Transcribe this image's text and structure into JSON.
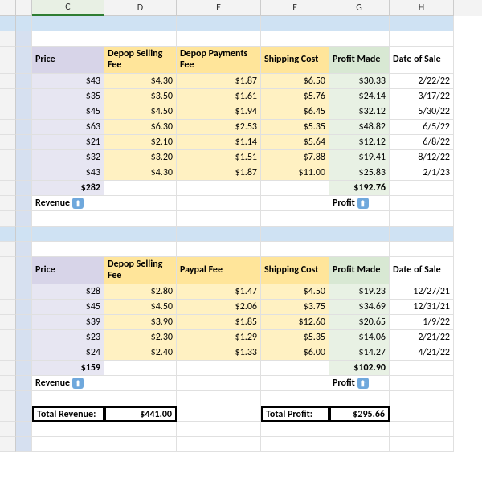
{
  "columns": [
    "",
    "",
    "C",
    "D",
    "E",
    "F",
    "G",
    "H"
  ],
  "selected_col": 2,
  "table1": {
    "headers": [
      "Price",
      "Depop Selling Fee",
      "Depop Payments Fee",
      "Shipping Cost",
      "Profit Made",
      "Date of Sale"
    ],
    "rows": [
      {
        "price": "$43",
        "fee1": "$4.30",
        "fee2": "$1.87",
        "ship": "$6.50",
        "profit": "$30.33",
        "date": "2/22/22"
      },
      {
        "price": "$35",
        "fee1": "$3.50",
        "fee2": "$1.61",
        "ship": "$5.76",
        "profit": "$24.14",
        "date": "3/17/22"
      },
      {
        "price": "$45",
        "fee1": "$4.50",
        "fee2": "$1.94",
        "ship": "$6.45",
        "profit": "$32.12",
        "date": "5/30/22"
      },
      {
        "price": "$63",
        "fee1": "$6.30",
        "fee2": "$2.53",
        "ship": "$5.35",
        "profit": "$48.82",
        "date": "6/5/22"
      },
      {
        "price": "$21",
        "fee1": "$2.10",
        "fee2": "$1.14",
        "ship": "$5.64",
        "profit": "$12.12",
        "date": "6/8/22"
      },
      {
        "price": "$32",
        "fee1": "$3.20",
        "fee2": "$1.51",
        "ship": "$7.88",
        "profit": "$19.41",
        "date": "8/12/22"
      },
      {
        "price": "$43",
        "fee1": "$4.30",
        "fee2": "$1.87",
        "ship": "$11.00",
        "profit": "$25.83",
        "date": "2/1/23"
      }
    ],
    "totals": {
      "price": "$282",
      "profit": "$192.76"
    },
    "labels": {
      "revenue": "Revenue",
      "profit": "Profit"
    }
  },
  "table2": {
    "headers": [
      "Price",
      "Depop Selling Fee",
      "Paypal Fee",
      "Shipping Cost",
      "Profit Made",
      "Date of Sale"
    ],
    "rows": [
      {
        "price": "$28",
        "fee1": "$2.80",
        "fee2": "$1.47",
        "ship": "$4.50",
        "profit": "$19.23",
        "date": "12/27/21"
      },
      {
        "price": "$45",
        "fee1": "$4.50",
        "fee2": "$2.06",
        "ship": "$3.75",
        "profit": "$34.69",
        "date": "12/31/21"
      },
      {
        "price": "$39",
        "fee1": "$3.90",
        "fee2": "$1.85",
        "ship": "$12.60",
        "profit": "$20.65",
        "date": "1/9/22"
      },
      {
        "price": "$23",
        "fee1": "$2.30",
        "fee2": "$1.29",
        "ship": "$5.35",
        "profit": "$14.06",
        "date": "2/21/22"
      },
      {
        "price": "$24",
        "fee1": "$2.40",
        "fee2": "$1.33",
        "ship": "$6.00",
        "profit": "$14.27",
        "date": "4/21/22"
      }
    ],
    "totals": {
      "price": "$159",
      "profit": "$102.90"
    },
    "labels": {
      "revenue": "Revenue",
      "profit": "Profit"
    }
  },
  "grand": {
    "rev_label": "Total Revenue:",
    "rev_value": "$441.00",
    "prof_label": "Total Profit:",
    "prof_value": "$295.66"
  }
}
